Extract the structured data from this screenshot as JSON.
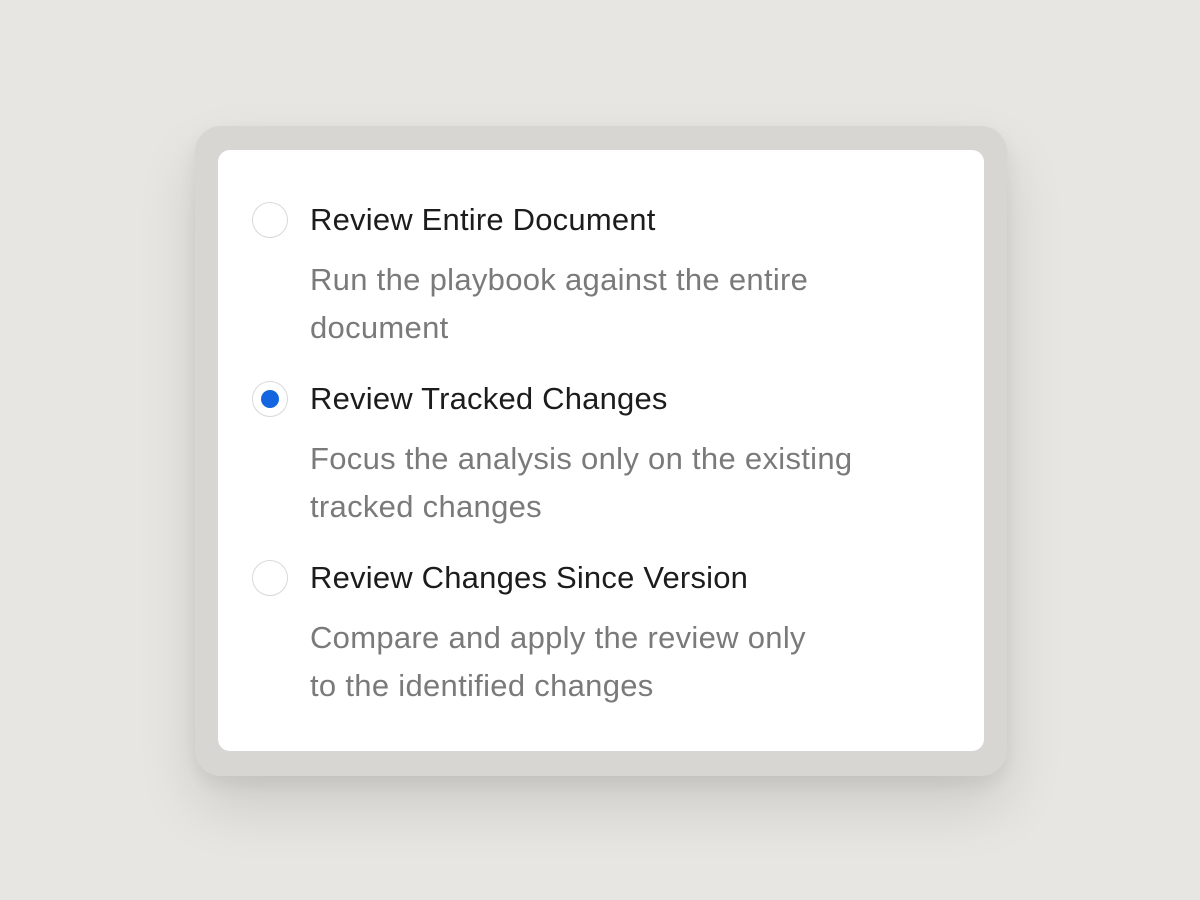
{
  "options": [
    {
      "title": "Review Entire Document",
      "description_lines": [
        "Run the playbook against the entire",
        "document"
      ],
      "selected": false
    },
    {
      "title": "Review Tracked Changes",
      "description_lines": [
        "Focus the analysis only on the existing",
        "tracked changes"
      ],
      "selected": true
    },
    {
      "title": "Review Changes Since Version",
      "description_lines": [
        "Compare and apply the review only",
        "to the identified changes"
      ],
      "selected": false
    }
  ],
  "colors": {
    "accent": "#1366e0",
    "background": "#e8e6e2",
    "title_text": "#1c1c1c",
    "description_text": "#7a7a7a"
  }
}
